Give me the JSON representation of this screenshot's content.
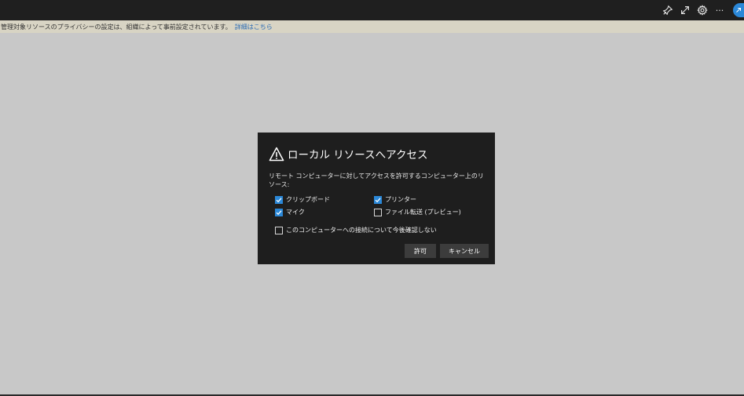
{
  "topbar": {
    "icons": [
      "unpin-icon",
      "expand-icon",
      "gear-icon",
      "more-icon",
      "avatar-icon"
    ],
    "more_label": "···"
  },
  "infobar": {
    "message": "管理対象リソースのプライバシーの設定は、組織によって事前設定されています。",
    "link": "詳細はこちら"
  },
  "dialog": {
    "title": "ローカル リソースへアクセス",
    "description": "リモート コンピューターに対してアクセスを許可するコンピューター上のリソース:",
    "options": [
      {
        "label": "クリップボード",
        "checked": true
      },
      {
        "label": "プリンター",
        "checked": true
      },
      {
        "label": "マイク",
        "checked": true
      },
      {
        "label": "ファイル転送 (プレビュー)",
        "checked": false
      }
    ],
    "dont_ask": {
      "label": "このコンピューターへの接続について今後確認しない",
      "checked": false
    },
    "allow_label": "許可",
    "cancel_label": "キャンセル"
  },
  "colors": {
    "accent": "#2b88d8",
    "dialog_bg": "#1e1e1e",
    "backdrop": "#c8c8c8",
    "infobar_bg": "#d8d4c4",
    "link": "#2b6cb5"
  }
}
